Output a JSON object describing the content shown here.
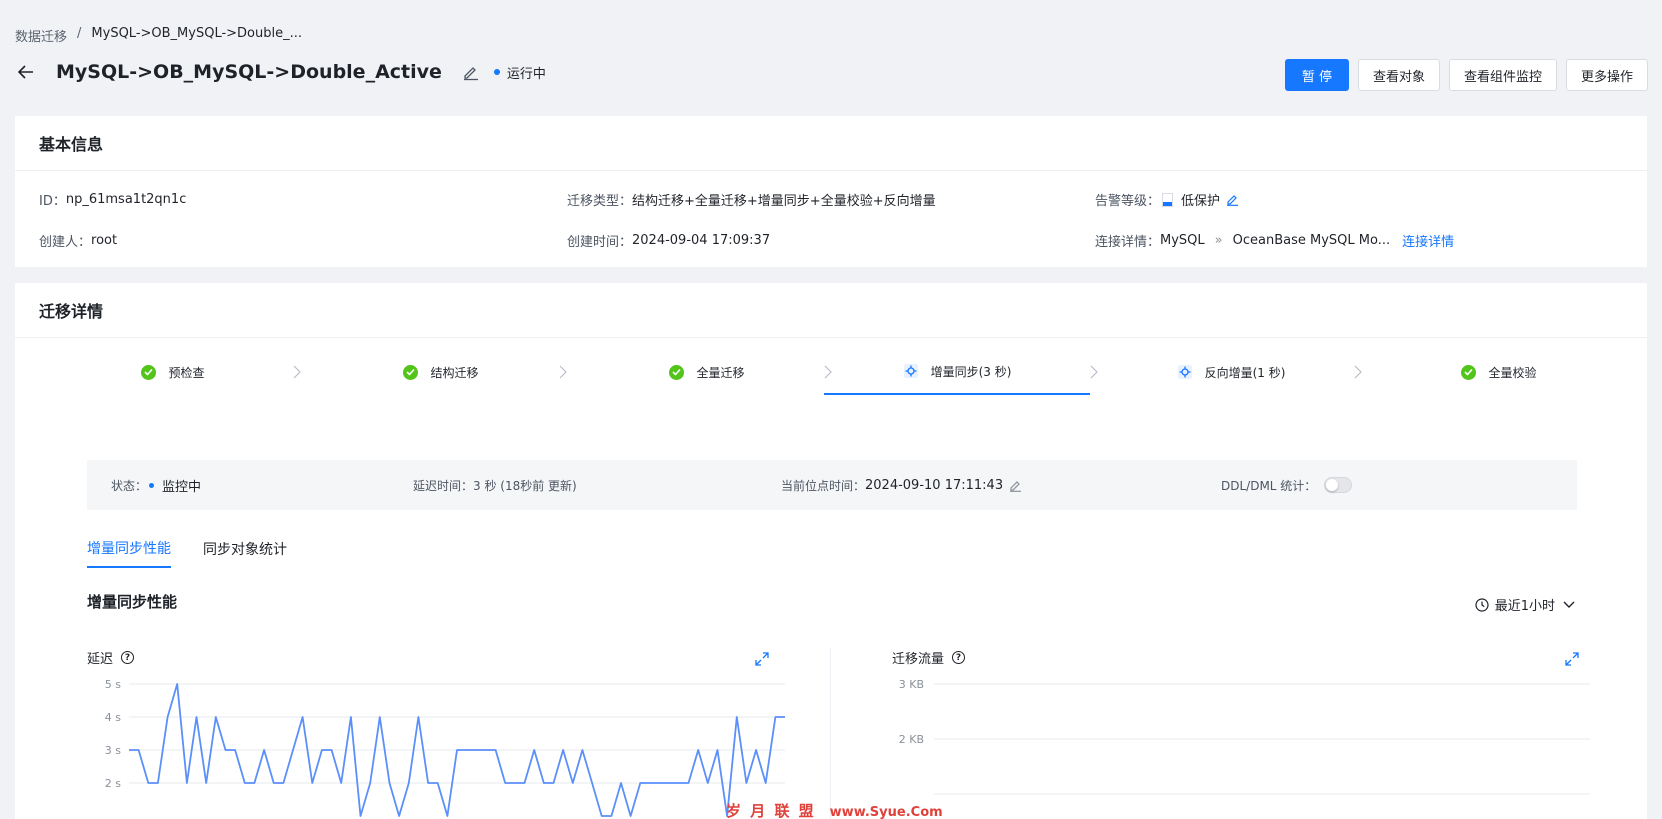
{
  "breadcrumb": {
    "root": "数据迁移",
    "separator": "/",
    "current": "MySQL->OB_MySQL->Double_..."
  },
  "header": {
    "title": "MySQL->OB_MySQL->Double_Active",
    "status": "运行中",
    "actions": {
      "pause": "暂 停",
      "view_objects": "查看对象",
      "view_monitor": "查看组件监控",
      "more": "更多操作"
    }
  },
  "basic_info": {
    "title": "基本信息",
    "id_label": "ID：",
    "id_value": "np_61msa1t2qn1c",
    "type_label": "迁移类型：",
    "type_value": "结构迁移+全量迁移+增量同步+全量校验+反向增量",
    "alert_label": "告警等级：",
    "alert_value": "低保护",
    "creator_label": "创建人：",
    "creator_value": "root",
    "created_label": "创建时间：",
    "created_value": "2024-09-04 17:09:37",
    "conn_label": "连接详情：",
    "conn_source": "MySQL",
    "conn_arrow": "»",
    "conn_target": "OceanBase MySQL Mo...",
    "conn_link": "连接详情"
  },
  "migration": {
    "title": "迁移详情",
    "steps": [
      {
        "label": "预检查",
        "state": "done"
      },
      {
        "label": "结构迁移",
        "state": "done"
      },
      {
        "label": "全量迁移",
        "state": "done"
      },
      {
        "label": "增量同步(3 秒)",
        "state": "running"
      },
      {
        "label": "反向增量(1 秒)",
        "state": "running"
      },
      {
        "label": "全量校验",
        "state": "done"
      }
    ],
    "status_bar": {
      "state_label": "状态：",
      "state_value": "监控中",
      "delay_label": "延迟时间：",
      "delay_value": "3 秒 (18秒前 更新)",
      "checkpoint_label": "当前位点时间：",
      "checkpoint_value": "2024-09-10 17:11:43",
      "ddl_label": "DDL/DML 统计："
    },
    "tabs": [
      "增量同步性能",
      "同步对象统计"
    ],
    "section_title": "增量同步性能",
    "time_range": "最近1小时"
  },
  "colors": {
    "accent": "#1677ff",
    "success": "#52c41a",
    "line": "#5b8ff9"
  },
  "chart_data": [
    {
      "type": "line",
      "title": "延迟",
      "y_ticks": [
        "5 s",
        "4 s",
        "3 s",
        "2 s"
      ],
      "ylim": [
        2,
        5
      ],
      "x": [
        0,
        1,
        2,
        3,
        4,
        5,
        6,
        7,
        8,
        9,
        10,
        11,
        12,
        13,
        14,
        15,
        16,
        17,
        18,
        19,
        20,
        21,
        22,
        23,
        24,
        25,
        26,
        27,
        28,
        29,
        30,
        31,
        32,
        33,
        34,
        35,
        36,
        37,
        38,
        39,
        40,
        41,
        42,
        43,
        44,
        45,
        46,
        47,
        48,
        49,
        50,
        51,
        52,
        53,
        54,
        55,
        56,
        57,
        58,
        59,
        60,
        61,
        62,
        63,
        64,
        65,
        66,
        67,
        68
      ],
      "series": [
        {
          "values": [
            3,
            3,
            2,
            2,
            4,
            5,
            2,
            4,
            2,
            4,
            3,
            3,
            2,
            2,
            3,
            2,
            2,
            3,
            4,
            2,
            3,
            3,
            2,
            4,
            1,
            2,
            4,
            2,
            1,
            2,
            4,
            2,
            2,
            1,
            3,
            3,
            3,
            3,
            3,
            2,
            2,
            2,
            3,
            2,
            2,
            3,
            2,
            3,
            2,
            1,
            1,
            2,
            1,
            2,
            2,
            2,
            2,
            2,
            2,
            3,
            2,
            3,
            1,
            4,
            2,
            3,
            2,
            4,
            4
          ]
        }
      ]
    },
    {
      "type": "line",
      "title": "迁移流量",
      "y_ticks": [
        "3 KB",
        "2 KB"
      ],
      "ylim": [
        1,
        3
      ],
      "series": []
    }
  ],
  "watermark": {
    "text": "岁 月 联 盟",
    "url": "www.Syue.Com"
  }
}
